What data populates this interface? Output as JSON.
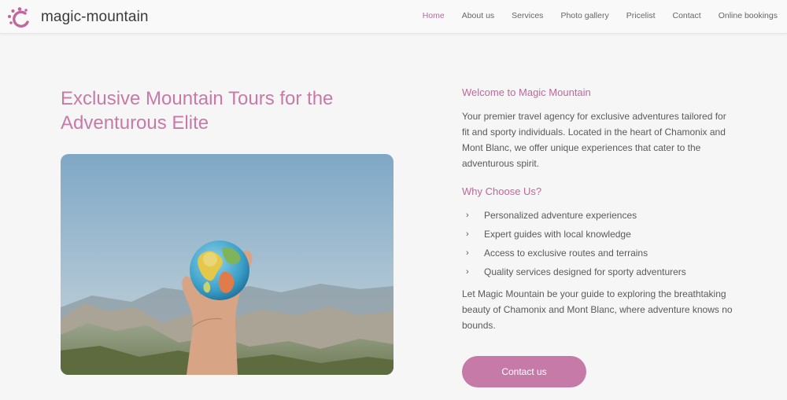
{
  "brand": {
    "name": "magic-mountain",
    "accent": "#c0679c"
  },
  "nav": {
    "items": [
      {
        "label": "Home",
        "active": true
      },
      {
        "label": "About us"
      },
      {
        "label": "Services"
      },
      {
        "label": "Photo gallery"
      },
      {
        "label": "Pricelist"
      },
      {
        "label": "Contact"
      },
      {
        "label": "Online bookings"
      }
    ]
  },
  "hero": {
    "title": "Exclusive Mountain Tours for the Adventurous Elite",
    "image": "hand-holding-globe-over-mountains"
  },
  "welcome": {
    "title": "Welcome to Magic Mountain",
    "text": "Your premier travel agency for exclusive adventures tailored for fit and sporty individuals. Located in the heart of Chamonix and Mont Blanc, we offer unique experiences that cater to the adventurous spirit."
  },
  "why": {
    "title": "Why Choose Us?",
    "items": [
      "Personalized adventure experiences",
      "Expert guides with local knowledge",
      "Access to exclusive routes and terrains",
      "Quality services designed for sporty adventurers"
    ]
  },
  "outro": "Let Magic Mountain be your guide to exploring the breathtaking beauty of Chamonix and Mont Blanc, where adventure knows no bounds.",
  "cta": {
    "label": "Contact us"
  }
}
